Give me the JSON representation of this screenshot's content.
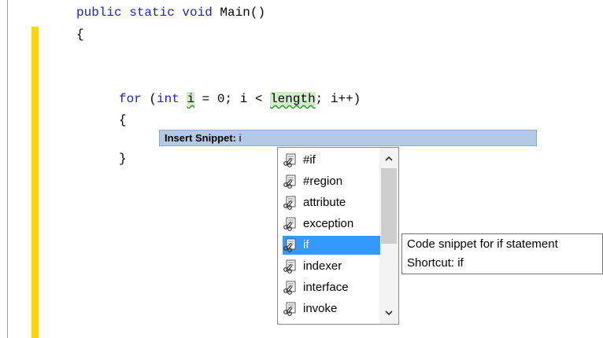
{
  "code": {
    "line1_kw": "public static void",
    "line1_rest": " Main()",
    "brace_open": "{",
    "for_kw": "for",
    "for_paren": " (",
    "int_kw": "int",
    "var_i": "i",
    "for_mid": " = 0; i < ",
    "length_id": "length",
    "for_end": "; i++)",
    "inner_open": "{",
    "inner_close": "}"
  },
  "snippet_bar": {
    "label": "Insert Snippet:",
    "value": " i"
  },
  "completion_list": {
    "items": [
      {
        "label": "#if",
        "icon": "snippet-icon"
      },
      {
        "label": "#region",
        "icon": "snippet-icon"
      },
      {
        "label": "attribute",
        "icon": "snippet-icon"
      },
      {
        "label": "exception",
        "icon": "snippet-icon"
      },
      {
        "label": "if",
        "icon": "snippet-icon",
        "selected": true
      },
      {
        "label": "indexer",
        "icon": "snippet-icon"
      },
      {
        "label": "interface",
        "icon": "snippet-icon"
      },
      {
        "label": "invoke",
        "icon": "snippet-icon"
      }
    ]
  },
  "tooltip": {
    "description": "Code snippet for if statement",
    "shortcut": "Shortcut: if"
  },
  "colors": {
    "keyword": "#1f1fbf",
    "selection": "#3399ff",
    "change_bar": "#ffd700",
    "snippet_bar": "#b4c9e2"
  }
}
